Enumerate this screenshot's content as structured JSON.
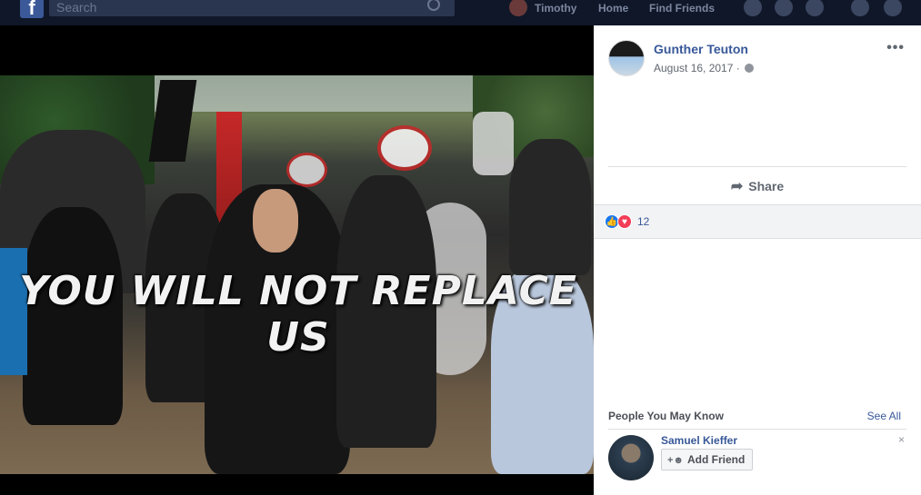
{
  "topbar": {
    "search_placeholder": "Search",
    "user_name": "Timothy",
    "home_label": "Home",
    "find_friends_label": "Find Friends"
  },
  "photo": {
    "overlay_text": "YOU WILL NOT REPLACE US"
  },
  "post": {
    "author": "Gunther Teuton",
    "date": "August 16, 2017 ·",
    "more": "•••",
    "share_label": "Share",
    "reaction_count": "12"
  },
  "pymk": {
    "title": "People You May Know",
    "see_all": "See All",
    "suggestion_name": "Samuel Kieffer",
    "add_friend_label": "Add Friend",
    "close": "×"
  },
  "colors": {
    "link": "#385898",
    "like": "#1877f2",
    "love": "#f33e58"
  }
}
